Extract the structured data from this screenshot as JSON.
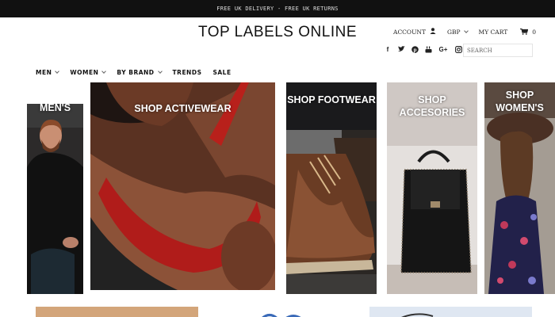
{
  "announcement": "FREE UK DELIVERY - FREE UK RETURNS",
  "logo": "TOP LABELS ONLINE",
  "account": {
    "account_label": "ACCOUNT",
    "currency": "GBP",
    "cart_label": "MY CART",
    "cart_count": "0"
  },
  "social": [
    "facebook-icon",
    "twitter-icon",
    "pinterest-icon",
    "youtube-icon",
    "google-plus-icon",
    "instagram-icon"
  ],
  "search": {
    "placeholder": "SEARCH"
  },
  "nav": [
    {
      "label": "MEN",
      "dropdown": true
    },
    {
      "label": "WOMEN",
      "dropdown": true
    },
    {
      "label": "BY BRAND",
      "dropdown": true
    },
    {
      "label": "TRENDS",
      "dropdown": false
    },
    {
      "label": "SALE",
      "dropdown": false
    }
  ],
  "tiles": {
    "mens": "SHOP MEN'S",
    "activewear": "SHOP ACTIVEWEAR",
    "footwear": "SHOP FOOTWEAR",
    "accessories": "SHOP ACCESORIES",
    "womens": "SHOP WOMEN'S"
  }
}
